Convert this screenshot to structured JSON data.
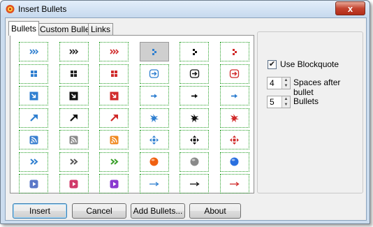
{
  "window": {
    "title": "Insert Bullets",
    "close_symbol": "x"
  },
  "tabs": [
    {
      "label": "Bullets",
      "active": true
    },
    {
      "label": "Custom Bullets",
      "active": false
    },
    {
      "label": "Links",
      "active": false
    }
  ],
  "grid": {
    "columns": 6,
    "selected_index": 3,
    "cells": [
      {
        "icon": "triple-chevron-right-icon",
        "color": "#2f7fd0"
      },
      {
        "icon": "triple-chevron-right-icon",
        "color": "#222222"
      },
      {
        "icon": "triple-chevron-right-icon",
        "color": "#d02a2a"
      },
      {
        "icon": "dots-pointer-icon",
        "color": "#2f7fd0"
      },
      {
        "icon": "dots-pointer-icon",
        "color": "#111111"
      },
      {
        "icon": "dots-pointer-icon",
        "color": "#d02a2a"
      },
      {
        "icon": "four-squares-icon",
        "color": "#2f7fd0"
      },
      {
        "icon": "four-squares-icon",
        "color": "#222222"
      },
      {
        "icon": "four-squares-icon",
        "color": "#d02a2a"
      },
      {
        "icon": "boxed-arrow-right-icon",
        "color": "#2f7fd0"
      },
      {
        "icon": "boxed-arrow-right-icon",
        "color": "#111111"
      },
      {
        "icon": "boxed-arrow-right-icon",
        "color": "#d02a2a"
      },
      {
        "icon": "square-arrow-down-right-icon",
        "color": "#2f7fd0"
      },
      {
        "icon": "square-arrow-down-right-icon",
        "color": "#111111"
      },
      {
        "icon": "square-arrow-down-right-icon",
        "color": "#d02a2a"
      },
      {
        "icon": "small-arrow-right-icon",
        "color": "#2f7fd0"
      },
      {
        "icon": "small-arrow-right-icon",
        "color": "#111111"
      },
      {
        "icon": "small-arrow-right-icon",
        "color": "#2f7fd0"
      },
      {
        "icon": "arrow-up-right-icon",
        "color": "#2f7fd0"
      },
      {
        "icon": "arrow-up-right-icon",
        "color": "#111111"
      },
      {
        "icon": "arrow-up-right-icon",
        "color": "#d02a2a"
      },
      {
        "icon": "splat-arrow-icon",
        "color": "#2f7fd0"
      },
      {
        "icon": "splat-arrow-icon",
        "color": "#111111"
      },
      {
        "icon": "splat-arrow-icon",
        "color": "#d02a2a"
      },
      {
        "icon": "rss-feed-icon",
        "color": "#3a7fd0"
      },
      {
        "icon": "rss-feed-icon",
        "color": "#8a8a8a"
      },
      {
        "icon": "rss-feed-icon",
        "color": "#f08a20"
      },
      {
        "icon": "four-way-arrow-icon",
        "color": "#2f7fd0"
      },
      {
        "icon": "four-way-arrow-icon",
        "color": "#111111"
      },
      {
        "icon": "four-way-arrow-icon",
        "color": "#d02a2a"
      },
      {
        "icon": "double-chevron-right-icon",
        "color": "#2f7fd0"
      },
      {
        "icon": "double-chevron-right-icon",
        "color": "#555555"
      },
      {
        "icon": "double-chevron-right-icon",
        "color": "#3aa02a"
      },
      {
        "icon": "orb-icon",
        "color": "#f06010"
      },
      {
        "icon": "orb-icon",
        "color": "#8a8a8a"
      },
      {
        "icon": "orb-icon",
        "color": "#2a70e0"
      },
      {
        "icon": "play-square-icon",
        "color": "#5a78c8"
      },
      {
        "icon": "play-square-icon",
        "color": "#d03a6a"
      },
      {
        "icon": "play-square-icon",
        "color": "#8a3ad0"
      },
      {
        "icon": "long-arrow-right-icon",
        "color": "#2f7fd0"
      },
      {
        "icon": "long-arrow-right-icon",
        "color": "#111111"
      },
      {
        "icon": "long-arrow-right-icon",
        "color": "#d02a2a"
      }
    ]
  },
  "options": {
    "use_blockquote": {
      "label": "Use Blockquote",
      "checked": true
    },
    "spaces_after_bullet": {
      "value": "4",
      "label": "Spaces after bullet"
    },
    "bullets": {
      "value": "5",
      "label": "Bullets"
    }
  },
  "buttons": {
    "insert": "Insert",
    "cancel": "Cancel",
    "add_bullets": "Add Bullets...",
    "about": "About"
  }
}
